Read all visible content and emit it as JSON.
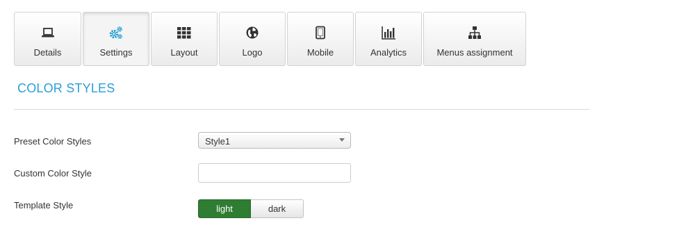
{
  "tabs": [
    {
      "label": "Details",
      "icon": "laptop-icon",
      "active": false
    },
    {
      "label": "Settings",
      "icon": "gears-icon",
      "active": true
    },
    {
      "label": "Layout",
      "icon": "grid-icon",
      "active": false
    },
    {
      "label": "Logo",
      "icon": "globe-icon",
      "active": false
    },
    {
      "label": "Mobile",
      "icon": "tablet-icon",
      "active": false
    },
    {
      "label": "Analytics",
      "icon": "bar-chart-icon",
      "active": false
    },
    {
      "label": "Menus assignment",
      "icon": "sitemap-icon",
      "active": false
    }
  ],
  "section": {
    "title": "COLOR STYLES"
  },
  "fields": {
    "preset": {
      "label": "Preset Color Styles",
      "value": "Style1"
    },
    "custom": {
      "label": "Custom Color Style",
      "value": "",
      "placeholder": ""
    },
    "template": {
      "label": "Template Style",
      "options": [
        "light",
        "dark"
      ],
      "selected": "light"
    }
  },
  "colors": {
    "accent": "#2a9fd6",
    "icon_active": "#2a9fd6",
    "icon": "#333333",
    "toggle_selected": "#2e7d32"
  }
}
